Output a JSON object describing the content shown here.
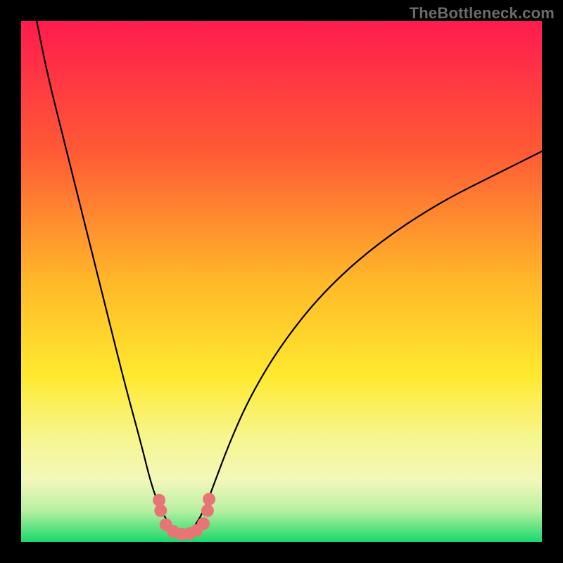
{
  "watermark": "TheBottleneck.com",
  "chart_data": {
    "type": "line",
    "title": "",
    "xlabel": "",
    "ylabel": "",
    "xlim": [
      0,
      100
    ],
    "ylim": [
      0,
      100
    ],
    "optimum_x": 31,
    "background_gradient": {
      "stops": [
        {
          "pos": 0.0,
          "color": "#ff1b4e"
        },
        {
          "pos": 0.25,
          "color": "#ff5a35"
        },
        {
          "pos": 0.5,
          "color": "#ffb829"
        },
        {
          "pos": 0.68,
          "color": "#ffe92e"
        },
        {
          "pos": 0.8,
          "color": "#f6f68e"
        },
        {
          "pos": 0.88,
          "color": "#f3f7bb"
        },
        {
          "pos": 0.94,
          "color": "#b8f0a0"
        },
        {
          "pos": 1.0,
          "color": "#18d86b"
        }
      ]
    },
    "series": [
      {
        "name": "bottleneck-curve",
        "x": [
          3,
          5,
          8,
          11,
          14,
          17,
          20,
          23,
          25,
          26.5,
          28,
          29.5,
          31,
          32.5,
          34,
          35.5,
          37,
          40,
          44,
          50,
          58,
          68,
          80,
          92,
          100
        ],
        "y": [
          100,
          90,
          78,
          66,
          54,
          42,
          30,
          19,
          11,
          7,
          4,
          2,
          1.3,
          2,
          4,
          7,
          11,
          19,
          28,
          38,
          48,
          57,
          65,
          71,
          75
        ]
      }
    ],
    "dots": {
      "name": "samples",
      "color": "#e87576",
      "points": [
        {
          "x": 26.5,
          "y": 8.0
        },
        {
          "x": 26.8,
          "y": 6.0
        },
        {
          "x": 27.8,
          "y": 3.3
        },
        {
          "x": 29.2,
          "y": 2.0
        },
        {
          "x": 30.8,
          "y": 1.5
        },
        {
          "x": 32.3,
          "y": 1.6
        },
        {
          "x": 33.7,
          "y": 2.2
        },
        {
          "x": 35.0,
          "y": 3.5
        },
        {
          "x": 35.8,
          "y": 6.0
        },
        {
          "x": 36.1,
          "y": 8.2
        }
      ]
    }
  }
}
